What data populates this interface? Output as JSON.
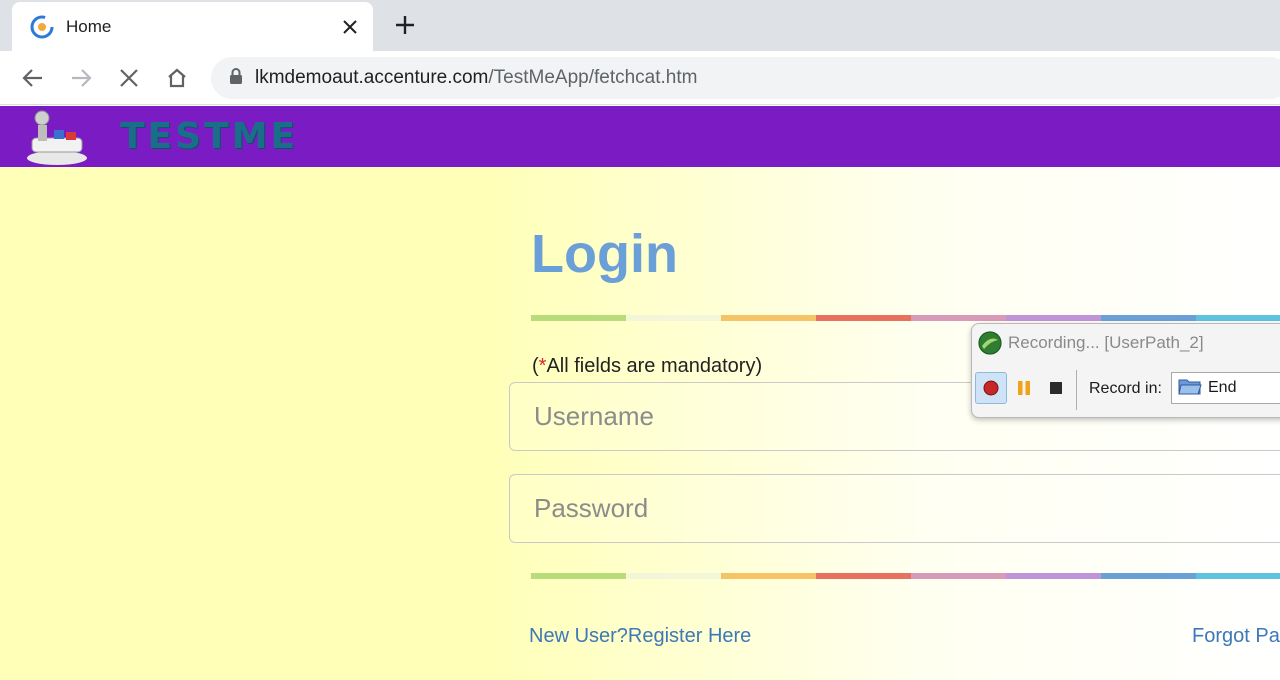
{
  "browser": {
    "tab_title": "Home",
    "url_host": "lkmdemoaut.accenture.com",
    "url_path": "/TestMeApp/fetchcat.htm"
  },
  "site": {
    "logo_text": "TESTME"
  },
  "login": {
    "title": "Login",
    "mandatory_prefix": "(",
    "mandatory_star": "*",
    "mandatory_text": "All fields are mandatory)",
    "username_placeholder": "Username",
    "password_placeholder": "Password",
    "register_link": "New User?Register Here",
    "forgot_link": "Forgot Pa"
  },
  "recorder": {
    "title": "Recording... [UserPath_2]",
    "record_in_label": "Record in:",
    "record_in_value": "End"
  },
  "colors": {
    "header_purple": "#7a1bc4",
    "page_yellow": "#ffffb8",
    "login_blue": "#6a9fd8",
    "link_blue": "#3d78b8",
    "stripe": [
      "#b9dc7a",
      "#f3f6d8",
      "#f6c466",
      "#e8705e",
      "#d89ab8",
      "#bf94d8",
      "#6a9fd8",
      "#5ec3e0"
    ]
  }
}
